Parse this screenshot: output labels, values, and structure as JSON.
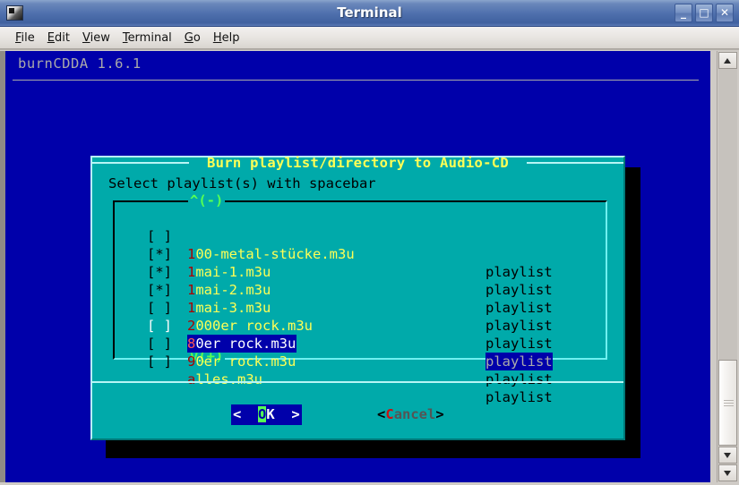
{
  "window": {
    "title": "Terminal",
    "icon": "terminal-icon",
    "controls": [
      {
        "name": "minimize",
        "glyph": "_"
      },
      {
        "name": "maximize",
        "glyph": "□"
      },
      {
        "name": "close",
        "glyph": "✕"
      }
    ]
  },
  "menubar": {
    "items": [
      {
        "name": "file",
        "pre": "",
        "hot": "F",
        "post": "ile"
      },
      {
        "name": "edit",
        "pre": "",
        "hot": "E",
        "post": "dit"
      },
      {
        "name": "view",
        "pre": "",
        "hot": "V",
        "post": "iew"
      },
      {
        "name": "terminal",
        "pre": "",
        "hot": "T",
        "post": "erminal"
      },
      {
        "name": "go",
        "pre": "",
        "hot": "G",
        "post": "o"
      },
      {
        "name": "help",
        "pre": "",
        "hot": "H",
        "post": "elp"
      }
    ]
  },
  "terminal": {
    "app_header": "burnCDDA 1.6.1"
  },
  "dialog": {
    "title": "Burn playlist/directory to Audio-CD",
    "prompt": "Select playlist(s) with spacebar",
    "scroll_up_indicator": "^(-)",
    "scroll_down_indicator": "v(+)",
    "items": [
      {
        "checkbox": "[ ]",
        "hot": "1",
        "rest": "00-metal-stücke.m3u",
        "tag": "playlist",
        "selected": false,
        "checked": false
      },
      {
        "checkbox": "[*]",
        "hot": "1",
        "rest": "mai-1.m3u",
        "tag": "playlist",
        "selected": false,
        "checked": true
      },
      {
        "checkbox": "[*]",
        "hot": "1",
        "rest": "mai-2.m3u",
        "tag": "playlist",
        "selected": false,
        "checked": true
      },
      {
        "checkbox": "[*]",
        "hot": "1",
        "rest": "mai-3.m3u",
        "tag": "playlist",
        "selected": false,
        "checked": true
      },
      {
        "checkbox": "[ ]",
        "hot": "2",
        "rest": "000er rock.m3u",
        "tag": "playlist",
        "selected": false,
        "checked": false
      },
      {
        "checkbox": "[ ]",
        "hot": "8",
        "rest": "0er rock.m3u",
        "tag": "playlist",
        "selected": true,
        "checked": false
      },
      {
        "checkbox": "[ ]",
        "hot": "9",
        "rest": "0er rock.m3u",
        "tag": "playlist",
        "selected": false,
        "checked": false
      },
      {
        "checkbox": "[ ]",
        "hot": "a",
        "rest": "lles.m3u",
        "tag": "playlist",
        "selected": false,
        "checked": false
      }
    ],
    "buttons": {
      "ok": {
        "left_arrow": "<  ",
        "hot": "O",
        "rest": "K",
        "right_arrow": "  >",
        "focused": true
      },
      "cancel": {
        "open": "<",
        "hot": "C",
        "rest": "ancel",
        "close": ">",
        "focused": false
      }
    }
  },
  "colors": {
    "terminal_bg": "#0000aa",
    "dialog_bg": "#00aaaa",
    "title_yellow": "#ffff55",
    "highlight_bg": "#0000aa",
    "hotkey_red": "#aa0000",
    "indicator_green": "#55ff55"
  }
}
